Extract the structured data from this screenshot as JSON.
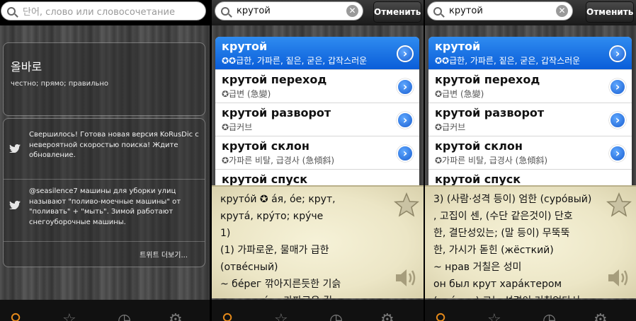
{
  "screen1": {
    "search_placeholder": "단어, слово или словосочетание",
    "word_card": {
      "word": "올바로",
      "definition": "честно; прямо; правильно"
    },
    "tweets": [
      {
        "text": "Свершилось! Готова новая версия KoRusDic с невероятной скоростью поиска! Ждите обновление."
      },
      {
        "text": "@seasilence7 машины для уборки улиц называют \"поливо-моечные машины\" от \"поливать\" + \"мыть\". Зимой работают снегоуборочные машины."
      }
    ],
    "more_label": "트위트 더보기..."
  },
  "screen2": {
    "search_value": "крутой",
    "cancel_label": "Отменить",
    "results": [
      {
        "headword": "крутой",
        "sub": "✪✪급한, 가파른, 짙은, 굳은, 갑작스러운",
        "selected": true
      },
      {
        "headword": "крутой переход",
        "sub": "✪급변 (急變)"
      },
      {
        "headword": "крутой разворот",
        "sub": "✪급커브"
      },
      {
        "headword": "крутой склон",
        "sub": "✪가파른 비탈, 급경사 (急傾斜)"
      },
      {
        "headword": "крутой спуск",
        "sub": ""
      }
    ],
    "entry_lines": [
      "круто́й ✪ а́я, о́е;  крут,",
      "крута́, кру́то;  кру́че",
      "1)",
      "(1) 가파로운, 물매가 급한",
      "(отве́сный)",
      "~ бе́рег 깎아지른듯한 기슭",
      "~ая доро́га 가파르운 길"
    ]
  },
  "screen3": {
    "search_value": "крутой",
    "cancel_label": "Отменить",
    "results": [
      {
        "headword": "крутой",
        "sub": "✪✪급한, 가파른, 짙은, 굳은, 갑작스러운",
        "selected": true
      },
      {
        "headword": "крутой переход",
        "sub": "✪급변 (急變)"
      },
      {
        "headword": "крутой разворот",
        "sub": "✪급커브"
      },
      {
        "headword": "крутой склон",
        "sub": "✪가파른 비탈, 급경사 (急傾斜)"
      },
      {
        "headword": "крутой спуск",
        "sub": ""
      }
    ],
    "entry_lines": [
      "3) (사람·성격 등이) 엄한 (суро́вый)",
      ", 고집이 센,  (수단 같은것이) 단호",
      "한,  결단성있는;  (말 등이) 무뚝뚝",
      "한,  가시가 돋힌 (жёсткий)",
      "~ нрав 거칠은 성미",
      "он был крут хара́ктером",
      "(нра́вом) 그는 성격이 거칠었다서"
    ]
  },
  "icons": {
    "search": "search-icon",
    "clear": "clear-icon",
    "chevron": "chevron-right-icon",
    "star": "star-icon",
    "speaker": "speaker-icon",
    "twitter": "twitter-bird-icon"
  },
  "colors": {
    "selection": "#0a5ed9",
    "accent_tab": "#e68a1a",
    "panel_bg": "#ece6c6"
  }
}
